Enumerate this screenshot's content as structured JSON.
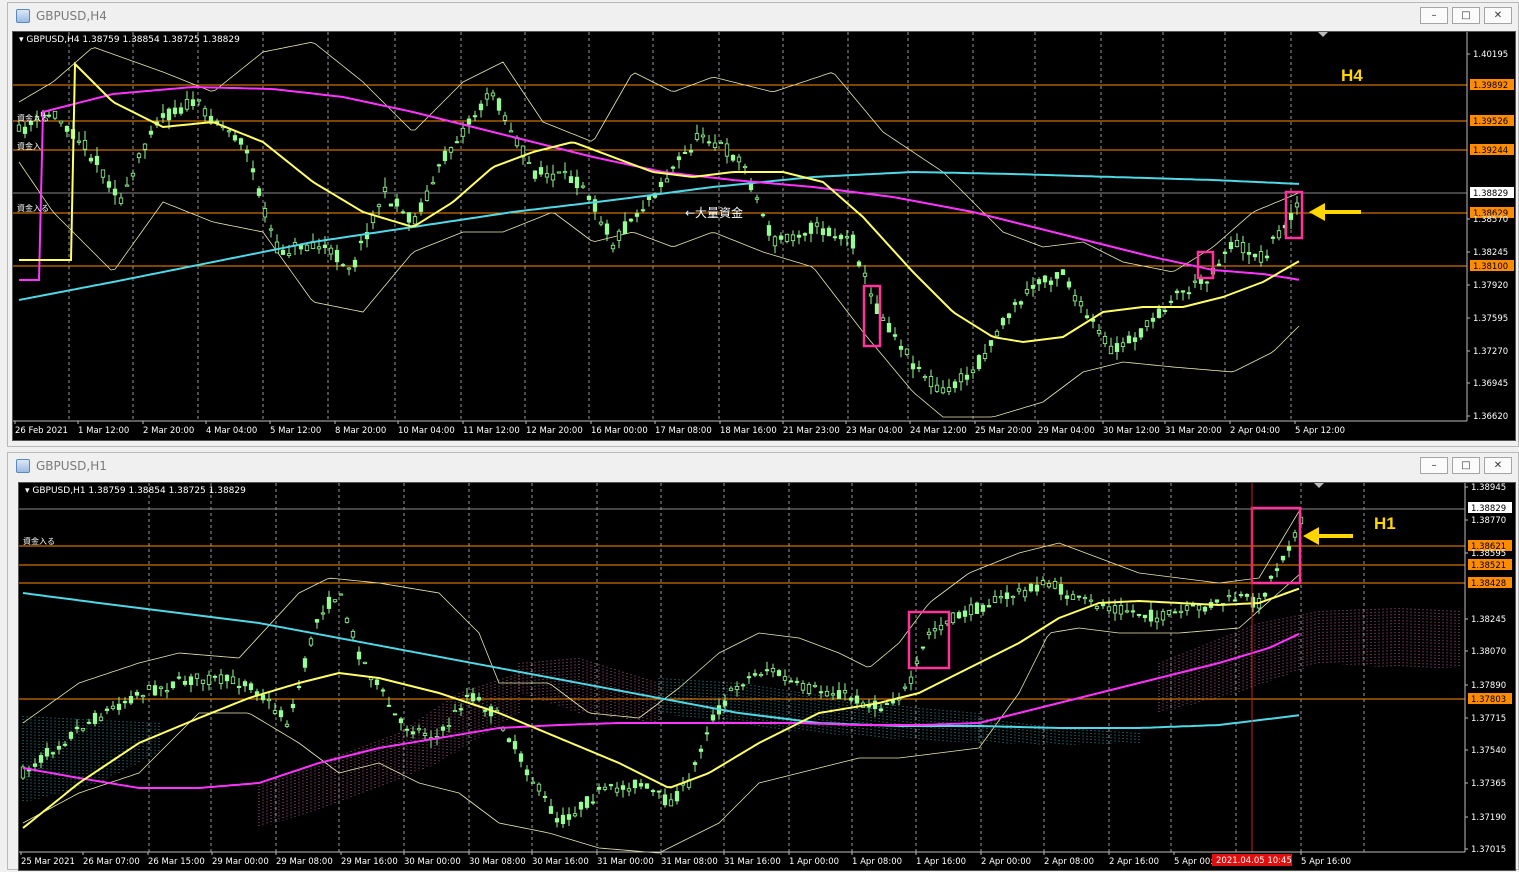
{
  "windows": [
    {
      "title": "GBPUSD,H4",
      "info": "GBPUSD,H4  1.38759 1.38854 1.38725 1.38829",
      "timeframe_tag": "H4",
      "annotation": "←大量資金",
      "fund_labels": [
        "資金入る",
        "資金入",
        "資金入る"
      ],
      "price_scale": [
        "1.40195",
        "1.39892",
        "1.39526",
        "1.39244",
        "1.38829",
        "1.38629",
        "1.38570",
        "1.38245",
        "1.38100",
        "1.37920",
        "1.37595",
        "1.37270",
        "1.36945",
        "1.36620"
      ],
      "highlight_prices": [
        {
          "value": "1.39892",
          "color": "#ff8c00"
        },
        {
          "value": "1.39526",
          "color": "#ff8c00"
        },
        {
          "value": "1.39244",
          "color": "#ff8c00"
        },
        {
          "value": "1.38629",
          "color": "#ff8c00"
        },
        {
          "value": "1.38100",
          "color": "#ff8c00"
        }
      ],
      "current_price": "1.38829",
      "time_axis": [
        "26 Feb 2021",
        "1 Mar 12:00",
        "2 Mar 20:00",
        "4 Mar 04:00",
        "5 Mar 12:00",
        "8 Mar 20:00",
        "10 Mar 04:00",
        "11 Mar 12:00",
        "12 Mar 20:00",
        "16 Mar 00:00",
        "17 Mar 08:00",
        "18 Mar 16:00",
        "21 Mar 23:00",
        "23 Mar 04:00",
        "24 Mar 12:00",
        "25 Mar 20:00",
        "29 Mar 04:00",
        "30 Mar 12:00",
        "31 Mar 20:00",
        "2 Apr 04:00",
        "5 Apr 12:00"
      ],
      "window_buttons": [
        "–",
        "□",
        "✕"
      ]
    },
    {
      "title": "GBPUSD,H1",
      "info": "GBPUSD,H1  1.38759 1.38854 1.38725 1.38829",
      "timeframe_tag": "H1",
      "fund_labels": [
        "資金入る"
      ],
      "price_scale": [
        "1.38945",
        "1.38829",
        "1.38770",
        "1.38621",
        "1.38595",
        "1.38521",
        "1.38428",
        "1.38245",
        "1.38070",
        "1.37890",
        "1.37803",
        "1.37715",
        "1.37540",
        "1.37365",
        "1.37190",
        "1.37015"
      ],
      "highlight_prices": [
        {
          "value": "1.38621",
          "color": "#ff8c00"
        },
        {
          "value": "1.38521",
          "color": "#ff8c00"
        },
        {
          "value": "1.38428",
          "color": "#ff8c00"
        },
        {
          "value": "1.37803",
          "color": "#ff8c00"
        }
      ],
      "current_price": "1.38829",
      "crosshair_time": "2021.04.05 10:45",
      "time_axis": [
        "25 Mar 2021",
        "26 Mar 07:00",
        "26 Mar 15:00",
        "29 Mar 00:00",
        "29 Mar 08:00",
        "29 Mar 16:00",
        "30 Mar 00:00",
        "30 Mar 08:00",
        "30 Mar 16:00",
        "31 Mar 00:00",
        "31 Mar 08:00",
        "31 Mar 16:00",
        "1 Apr 00:00",
        "1 Apr 08:00",
        "1 Apr 16:00",
        "2 Apr 00:00",
        "2 Apr 08:00",
        "2 Apr 16:00",
        "5 Apr 00:00",
        "5 Apr 16:00"
      ],
      "window_buttons": [
        "–",
        "□",
        "✕"
      ]
    }
  ],
  "colors": {
    "candle": "#98fb98",
    "ma_fast": "#ffff66",
    "ma_mid": "#ff33ff",
    "ma_slow": "#4fd8e6",
    "bollinger": "#e8e8b0",
    "level_line": "#ff8c00",
    "box": "#ff3399",
    "arrow": "#ffd700"
  }
}
